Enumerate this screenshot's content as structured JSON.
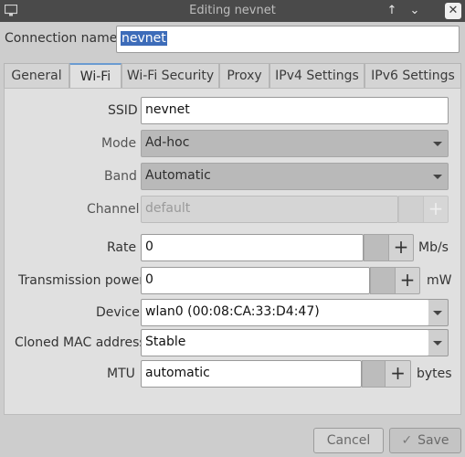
{
  "window": {
    "title": "Editing nevnet",
    "maximize_glyph": "↑",
    "minimize_glyph": "⌄",
    "close_glyph": "✕"
  },
  "connection_name": {
    "label": "Connection name",
    "value": "nevnet"
  },
  "tabs": [
    {
      "label": "General"
    },
    {
      "label": "Wi-Fi"
    },
    {
      "label": "Wi-Fi Security"
    },
    {
      "label": "Proxy"
    },
    {
      "label": "IPv4 Settings"
    },
    {
      "label": "IPv6 Settings"
    }
  ],
  "active_tab": "Wi-Fi",
  "wifi": {
    "ssid": {
      "label": "SSID",
      "value": "nevnet"
    },
    "mode": {
      "label": "Mode",
      "value": "Ad-hoc"
    },
    "band": {
      "label": "Band",
      "value": "Automatic"
    },
    "channel": {
      "label": "Channel",
      "value": "default"
    },
    "rate": {
      "label": "Rate",
      "value": "0",
      "unit": "Mb/s"
    },
    "tx_power": {
      "label": "Transmission power",
      "value": "0",
      "unit": "mW"
    },
    "device": {
      "label": "Device",
      "value": "wlan0 (00:08:CA:33:D4:47)"
    },
    "cloned_mac": {
      "label": "Cloned MAC address",
      "value": "Stable"
    },
    "mtu": {
      "label": "MTU",
      "value": "automatic",
      "unit": "bytes"
    }
  },
  "buttons": {
    "cancel": "Cancel",
    "save": "Save",
    "plus": "+",
    "save_icon": "✓"
  },
  "colors": {
    "selection": "#3d6cb9",
    "titlebar": "#4a4a4a",
    "panel": "#e0e0e0",
    "tab_accent": "#6a9bd1"
  }
}
